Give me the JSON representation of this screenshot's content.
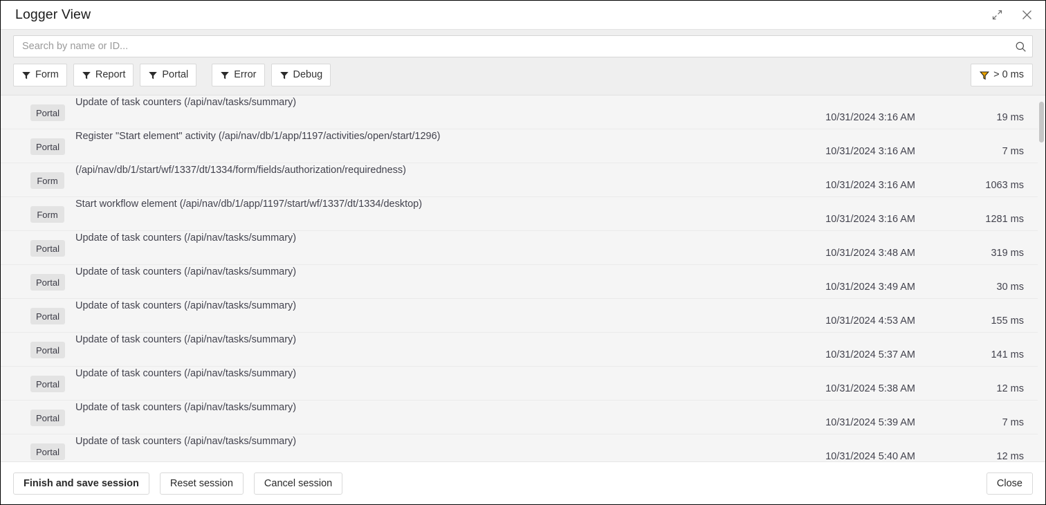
{
  "window": {
    "title": "Logger View",
    "expand_icon": "expand-icon",
    "close_icon": "close-icon"
  },
  "search": {
    "placeholder": "Search by name or ID...",
    "value": "",
    "icon": "search-icon"
  },
  "filters": {
    "icon": "funnel-icon",
    "type_filters": [
      "Form",
      "Report",
      "Portal"
    ],
    "level_filters": [
      "Error",
      "Debug"
    ],
    "duration_filter": {
      "label": "> 0 ms",
      "icon": "funnel-icon",
      "icon_color": "#e8a200"
    }
  },
  "log": {
    "rows": [
      {
        "category": "Portal",
        "message": "Update of task counters (/api/nav/tasks/summary)",
        "timestamp": "10/31/2024 3:16 AM",
        "duration": "19 ms"
      },
      {
        "category": "Portal",
        "message": "Register \"Start element\" activity (/api/nav/db/1/app/1197/activities/open/start/1296)",
        "timestamp": "10/31/2024 3:16 AM",
        "duration": "7 ms"
      },
      {
        "category": "Form",
        "message": "(/api/nav/db/1/start/wf/1337/dt/1334/form/fields/authorization/requiredness)",
        "timestamp": "10/31/2024 3:16 AM",
        "duration": "1063 ms"
      },
      {
        "category": "Form",
        "message": "Start workflow element (/api/nav/db/1/app/1197/start/wf/1337/dt/1334/desktop)",
        "timestamp": "10/31/2024 3:16 AM",
        "duration": "1281 ms"
      },
      {
        "category": "Portal",
        "message": "Update of task counters (/api/nav/tasks/summary)",
        "timestamp": "10/31/2024 3:48 AM",
        "duration": "319 ms"
      },
      {
        "category": "Portal",
        "message": "Update of task counters (/api/nav/tasks/summary)",
        "timestamp": "10/31/2024 3:49 AM",
        "duration": "30 ms"
      },
      {
        "category": "Portal",
        "message": "Update of task counters (/api/nav/tasks/summary)",
        "timestamp": "10/31/2024 4:53 AM",
        "duration": "155 ms"
      },
      {
        "category": "Portal",
        "message": "Update of task counters (/api/nav/tasks/summary)",
        "timestamp": "10/31/2024 5:37 AM",
        "duration": "141 ms"
      },
      {
        "category": "Portal",
        "message": "Update of task counters (/api/nav/tasks/summary)",
        "timestamp": "10/31/2024 5:38 AM",
        "duration": "12 ms"
      },
      {
        "category": "Portal",
        "message": "Update of task counters (/api/nav/tasks/summary)",
        "timestamp": "10/31/2024 5:39 AM",
        "duration": "7 ms"
      },
      {
        "category": "Portal",
        "message": "Update of task counters (/api/nav/tasks/summary)",
        "timestamp": "10/31/2024 5:40 AM",
        "duration": "12 ms"
      }
    ]
  },
  "footer": {
    "finish_label": "Finish and save session",
    "reset_label": "Reset session",
    "cancel_label": "Cancel session",
    "close_label": "Close"
  },
  "colors": {
    "toolbar_bg": "#efefef",
    "list_bg": "#f5f5f5",
    "badge_bg": "#e3e3e3",
    "text": "#43434e"
  }
}
